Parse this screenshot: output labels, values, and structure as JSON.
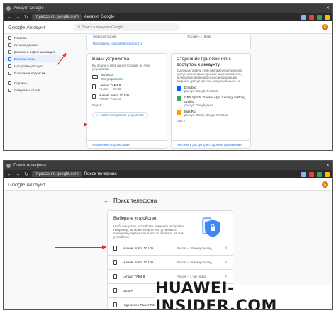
{
  "screen1": {
    "browser": {
      "url": "myaccount.google.com",
      "title": "Аккаунт Google"
    },
    "header": {
      "logo": "Google Аккаунт",
      "search_placeholder": "Поиск в аккаунте Google",
      "avatar_letter": "G"
    },
    "sidebar": {
      "items": [
        {
          "label": "Главная",
          "icon": "home-icon"
        },
        {
          "label": "Личные данные",
          "icon": "person-icon"
        },
        {
          "label": "Данные и персонализация",
          "icon": "toggle-icon"
        },
        {
          "label": "Безопасность",
          "icon": "lock-icon",
          "active": true
        },
        {
          "label": "Настройки доступа",
          "icon": "people-icon"
        },
        {
          "label": "Платежи и подписки",
          "icon": "card-icon"
        }
      ],
      "bottom": [
        {
          "label": "Справка",
          "icon": "help-icon"
        },
        {
          "label": "Отправить отзыв",
          "icon": "feedback-icon"
        }
      ]
    },
    "top_card": {
      "text": "сервисов Google",
      "time": "Россия — 19 авг",
      "link": "Посмотреть события безопасности"
    },
    "devices_card": {
      "title": "Ваши устройства",
      "desc": "Вы вошли в свой аккаунт Google на этих устройствах",
      "devices": [
        {
          "name": "Windows",
          "sub": "Это устройство"
        },
        {
          "name": "Lenovo TAB4 8",
          "sub": "Россия — 16:08"
        },
        {
          "name": "Huawei honor 10 Lite",
          "sub": "Россия — 16:02"
        }
      ],
      "more": "Ещё 4",
      "find_button": "Найти потерянное устройство",
      "manage_link": "Управление устройствами"
    },
    "apps_card": {
      "title": "Сторонние приложения с доступом к аккаунту",
      "desc": "Вы предоставили этим сайтам и приложениям доступ к некоторым данным вашего аккаунта, включая конфиденциальную информацию. Закройте доступ для тех, кому вы больше не доверяете.",
      "apps": [
        {
          "name": "Dropbox",
          "sub": "Доступ: Google Contacts",
          "color": "#0061fe"
        },
        {
          "name": "GPS Sports Tracker App: running, walking, cycling",
          "sub": "Доступ: Google Диск",
          "color": "#34a853"
        },
        {
          "name": "Mail.Ru",
          "sub": "Доступ: Gmail, Google Contacts",
          "color": "#ff9e00"
        }
      ],
      "more": "Ещё 7",
      "manage_link": "Настроить доступ для сторонних приложений"
    }
  },
  "screen2": {
    "browser": {
      "url": "myaccount.google.com",
      "title": "Поиск телефона"
    },
    "header": {
      "logo": "Google Аккаунт",
      "avatar_letter": "G"
    },
    "page": {
      "back": "←",
      "title": "Поиск телефона"
    },
    "select_card": {
      "title": "Выберите устройство",
      "desc": "Чтобы защитить устройство, измените настройки. Например, вы можете найти его, установить блокировку экрана или выйти из аккаунта на этом устройстве."
    },
    "devices": [
      {
        "name": "Huawei honor 10 Lite",
        "time": "Россия – 16 минут назад"
      },
      {
        "name": "Huawei honor 10 Lite",
        "time": "Россия – 16 минут назад"
      },
      {
        "name": "Lenovo TAB4 8",
        "time": "Россия – 1 час назад"
      },
      {
        "name": "Exco P",
        "time": "Россия – 4 июн."
      },
      {
        "name": "Highscreen Power Four",
        "time": "Россия – 21 мар."
      }
    ]
  },
  "watermark": "HUAWEI-INSIDER.COM",
  "colors": {
    "accent": "#1a73e8",
    "arrow": "#d93025",
    "chrome": "#3c3c3c"
  }
}
